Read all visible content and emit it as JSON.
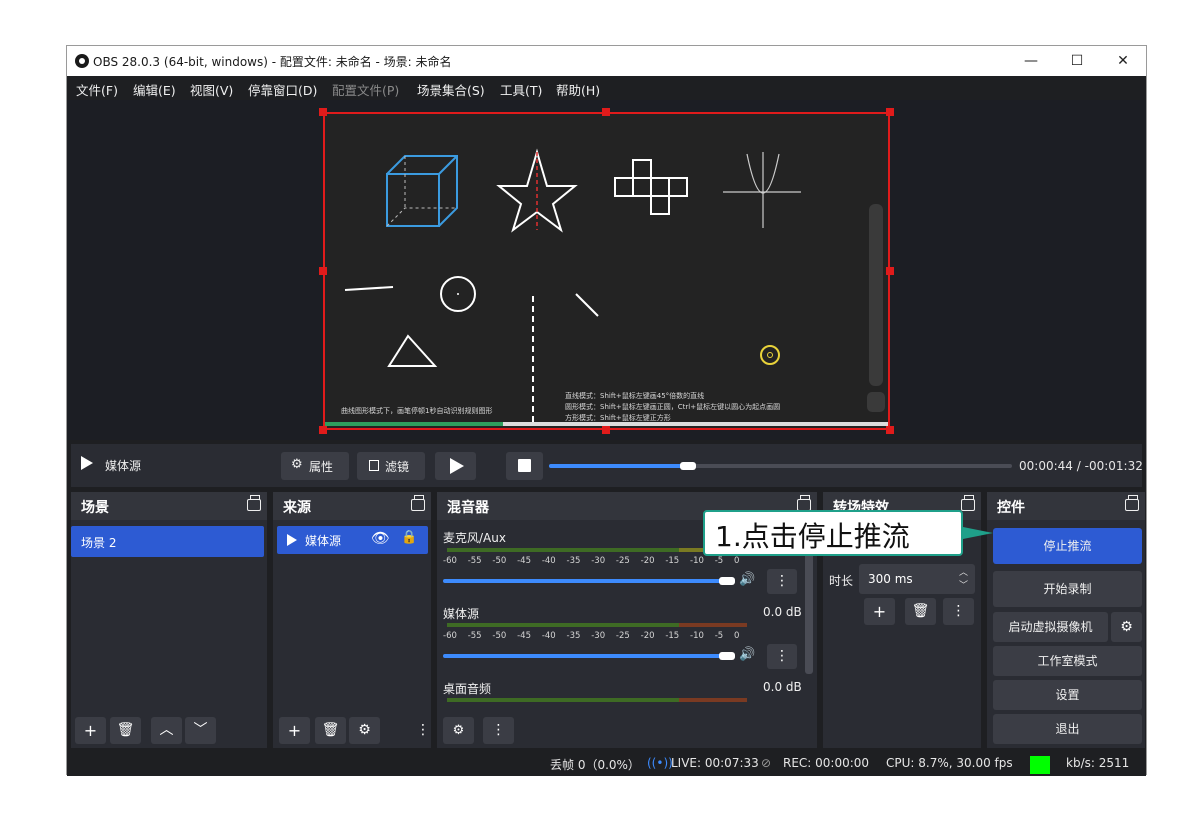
{
  "window": {
    "title": "OBS 28.0.3 (64-bit, windows) - 配置文件: 未命名 - 场景: 未命名",
    "controls": [
      "—",
      "☐",
      "✕"
    ]
  },
  "menu": [
    "文件(F)",
    "编辑(E)",
    "视图(V)",
    "停靠窗口(D)",
    "配置文件(P)",
    "场景集合(S)",
    "工具(T)",
    "帮助(H)"
  ],
  "preview": {
    "hint_left": "曲线图形模式下，画笔停顿1秒自动识别规则图形",
    "hint_right": [
      "直线模式：Shift+鼠标左键画45°倍数的直线",
      "圆形模式：Shift+鼠标左键画正圆，Ctrl+鼠标左键以圆心为起点画圆",
      "方形模式：Shift+鼠标左键正方形"
    ]
  },
  "media": {
    "source_name": "媒体源",
    "properties_label": "属性",
    "filters_label": "滤镜",
    "time_current": "00:00:44",
    "time_sep": "/",
    "time_remaining": "-00:01:32",
    "progress": 0.3
  },
  "scenes": {
    "title": "场景",
    "items": [
      "场景 2"
    ]
  },
  "sources": {
    "title": "来源",
    "items": [
      "媒体源"
    ]
  },
  "mixer": {
    "title": "混音器",
    "channels": [
      {
        "name": "麦克风/Aux",
        "db": ""
      },
      {
        "name": "媒体源",
        "db": "0.0 dB"
      },
      {
        "name": "桌面音频",
        "db": "0.0 dB"
      }
    ],
    "ticks": [
      "-60",
      "-55",
      "-50",
      "-45",
      "-40",
      "-35",
      "-30",
      "-25",
      "-20",
      "-15",
      "-10",
      "-5",
      "0"
    ]
  },
  "transitions": {
    "title": "转场特效",
    "duration_label": "时长",
    "duration_value": "300 ms"
  },
  "controls": {
    "title": "控件",
    "buttons": [
      "停止推流",
      "开始录制",
      "启动虚拟摄像机",
      "工作室模式",
      "设置",
      "退出"
    ]
  },
  "status": {
    "dropped": "丢帧 0（0.0%）",
    "live": "LIVE: 00:07:33",
    "rec": "REC: 00:00:00",
    "cpu": "CPU: 8.7%, 30.00 fps",
    "kbps": "kb/s: 2511",
    "indicator_color": "#00ff00"
  },
  "callout": {
    "text": "1.点击停止推流"
  },
  "colors": {
    "accent": "#2d5bd3",
    "selection": "#e01b1b",
    "cube": "#3b9be0",
    "callout_border": "#1fa08a"
  }
}
